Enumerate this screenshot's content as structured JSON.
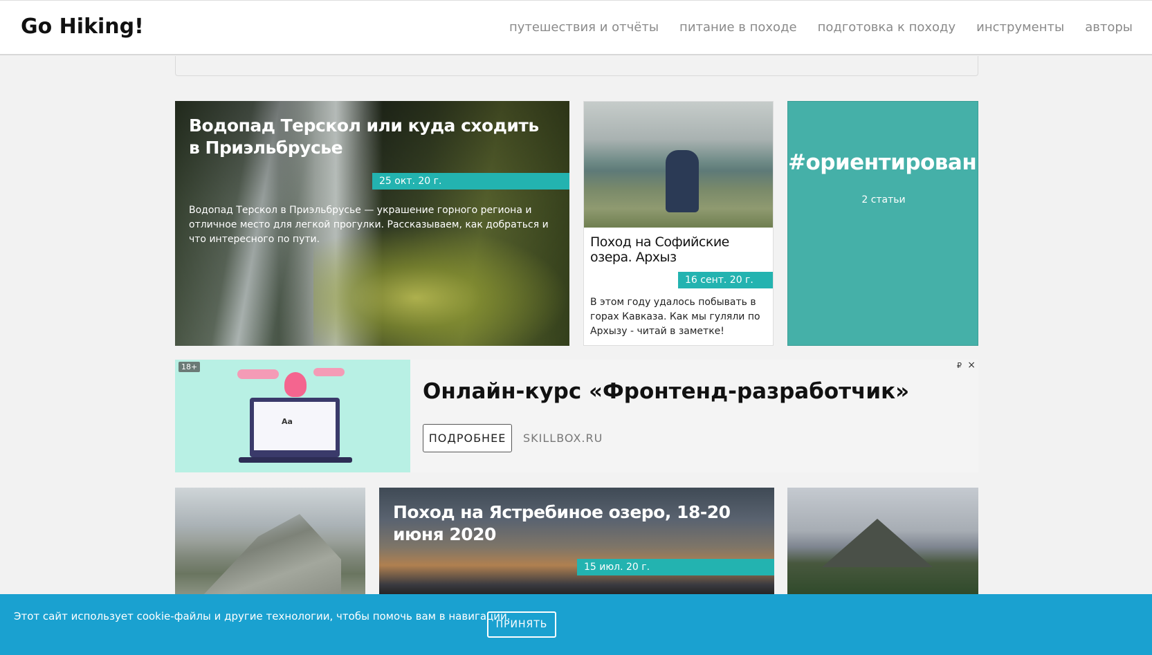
{
  "header": {
    "logo": "Go Hiking!",
    "nav": [
      {
        "label": "путешествия и отчёты"
      },
      {
        "label": "питание в походе"
      },
      {
        "label": "подготовка к походу"
      },
      {
        "label": "инструменты"
      },
      {
        "label": "авторы"
      }
    ]
  },
  "featured": {
    "title": "Водопад Терскол или куда сходить в Приэльбрусье",
    "date": "25 окт. 20 г.",
    "excerpt": "Водопад Терскол в Приэльбрусье — украшение горного региона и отличное место для легкой прогулки. Рассказываем, как добраться и что интересного по пути."
  },
  "small_card": {
    "title": "Поход на Софийские озера. Архыз",
    "date": "16 сент. 20 г.",
    "excerpt": "В этом году удалось побывать в горах Кавказа. Как мы гуляли по Архызу - читай в заметке!"
  },
  "tag_card": {
    "name": "#ориентирование",
    "count": "2 статьи"
  },
  "ad": {
    "age": "18+",
    "title": "Онлайн-курс «Фронтенд-разработчик»",
    "button": "ПОДРОБНЕЕ",
    "domain": "SKILLBOX.RU",
    "rub": "₽",
    "close": "×",
    "image_text": "Aa"
  },
  "row3": {
    "middle_title": "Поход на Ястребиное озеро, 18-20 июня 2020",
    "middle_date": "15 июл. 20 г."
  },
  "cookie": {
    "text": "Этот сайт использует cookie-файлы и другие технологии, чтобы помочь вам в навигации.",
    "button": "ПРИНЯТЬ"
  },
  "colors": {
    "accent": "#23b3b0",
    "tag_bg": "#45b0a8",
    "cookie_bg": "#1aa1d0"
  }
}
